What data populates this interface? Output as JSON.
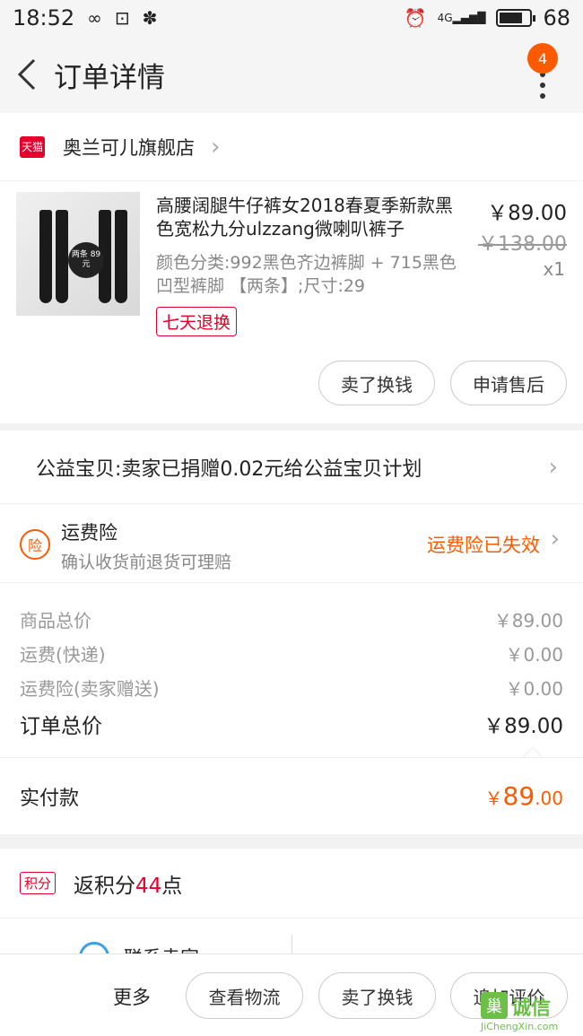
{
  "status_bar": {
    "time": "18:52",
    "icons": [
      "infinity-icon",
      "hotspot-icon",
      "baidu-paw-icon",
      "alarm-icon",
      "signal-4g-icon",
      "battery-icon"
    ],
    "network": "4G",
    "battery_percent": "68",
    "battery_level": 0.68
  },
  "nav": {
    "title": "订单详情",
    "badge_count": "4"
  },
  "store": {
    "icon_label": "天猫",
    "name": "奥兰可儿旗舰店"
  },
  "product": {
    "title": "高腰阔腿牛仔裤女2018春夏季新款黑色宽松九分ulzzang微喇叭裤子",
    "spec": "颜色分类:992黑色齐边裤脚 + 715黑色凹型裤脚 【两条】;尺寸:29",
    "return_policy": "七天退换",
    "price": "￥89.00",
    "original_price": "￥138.00",
    "quantity": "x1",
    "image_tag": "两条 89元",
    "buttons": {
      "sell": "卖了换钱",
      "after_sale": "申请售后"
    }
  },
  "charity": {
    "text": "公益宝贝:卖家已捐赠0.02元给公益宝贝计划"
  },
  "insurance": {
    "icon_label": "险",
    "title": "运费险",
    "subtitle": "确认收货前退货可理赔",
    "status": "运费险已失效"
  },
  "totals": {
    "rows": [
      {
        "label": "商品总价",
        "value": "￥89.00"
      },
      {
        "label": "运费(快递)",
        "value": "￥0.00"
      },
      {
        "label": "运费险(卖家赠送)",
        "value": "￥0.00"
      }
    ],
    "order_total_label": "订单总价",
    "order_total_value": "￥89.00"
  },
  "paid": {
    "label": "实付款",
    "currency": "￥",
    "integer": "89",
    "decimal": ".00"
  },
  "points": {
    "tag": "积分",
    "text_prefix": "返积分",
    "number": "44",
    "text_suffix": "点"
  },
  "contact": {
    "label": "联系卖家"
  },
  "action_bar": {
    "more": "更多",
    "logistics": "查看物流",
    "sell": "卖了换钱",
    "review": "追加评价"
  },
  "watermark": {
    "logo_char": "巢",
    "text": "诚信",
    "url": "JiChengXin.com"
  },
  "colors": {
    "accent": "#ff5a00",
    "tmall_red": "#e4002b",
    "page_bg": "#f2f2f2"
  }
}
